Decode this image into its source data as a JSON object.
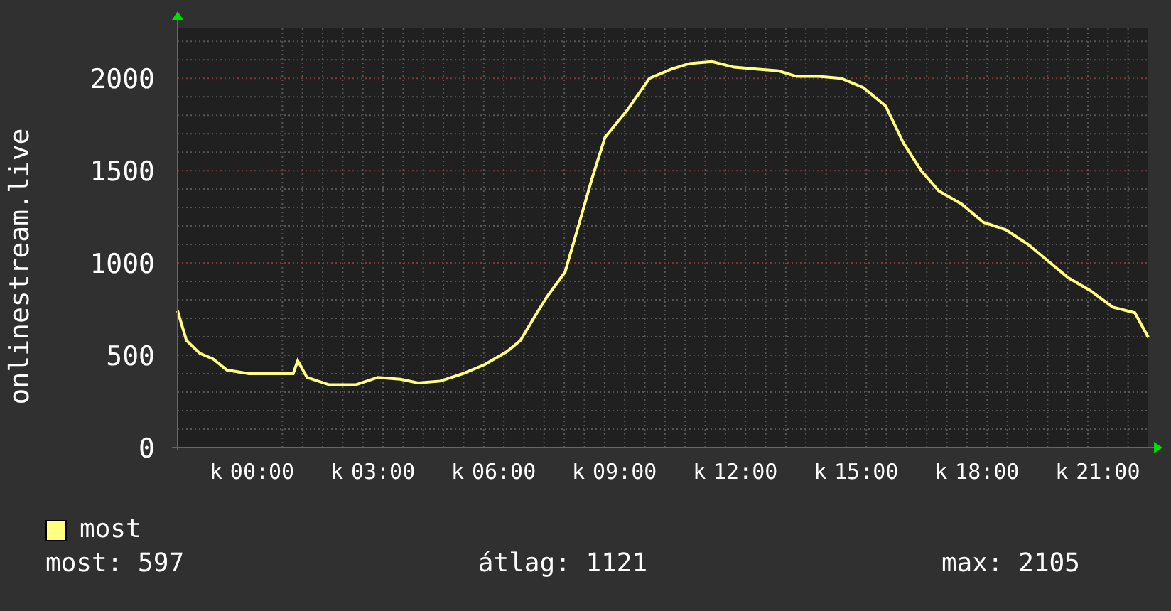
{
  "chart": {
    "chart_data": {
      "type": "line",
      "ylabel": "onlinestream.live",
      "grid": true,
      "x": [
        -2.1,
        -1.88,
        -1.55,
        -1.22,
        -0.88,
        -0.33,
        0.22,
        0.77,
        0.88,
        1.11,
        1.66,
        2.32,
        2.87,
        3.43,
        3.87,
        4.42,
        4.98,
        5.53,
        6.08,
        6.41,
        6.74,
        7.08,
        7.52,
        7.85,
        8.18,
        8.51,
        9.07,
        9.62,
        10.17,
        10.61,
        11.17,
        11.72,
        12.27,
        12.82,
        13.27,
        13.82,
        14.37,
        14.92,
        15.48,
        15.92,
        16.36,
        16.8,
        17.36,
        17.91,
        18.46,
        19.02,
        19.57,
        20.01,
        20.56,
        21.12,
        21.67,
        22.0
      ],
      "series": [
        {
          "name": "most",
          "color": "#ffff80",
          "values": [
            740,
            580,
            510,
            480,
            420,
            400,
            400,
            400,
            470,
            380,
            340,
            340,
            380,
            370,
            350,
            360,
            400,
            450,
            520,
            580,
            700,
            820,
            950,
            1200,
            1450,
            1680,
            1830,
            2000,
            2050,
            2080,
            2090,
            2060,
            2050,
            2040,
            2010,
            2010,
            2000,
            1950,
            1850,
            1650,
            1500,
            1390,
            1320,
            1220,
            1180,
            1100,
            1000,
            920,
            850,
            760,
            730,
            597
          ]
        }
      ],
      "xlim": [
        -2.1,
        22
      ],
      "ylim": [
        0,
        2270
      ],
      "xticks": [
        {
          "value": 0,
          "label": "00:00"
        },
        {
          "value": 3,
          "label": "03:00"
        },
        {
          "value": 6,
          "label": "06:00"
        },
        {
          "value": 9,
          "label": "09:00"
        },
        {
          "value": 12,
          "label": "12:00"
        },
        {
          "value": 15,
          "label": "15:00"
        },
        {
          "value": 18,
          "label": "18:00"
        },
        {
          "value": 21,
          "label": "21:00"
        }
      ],
      "yticks": [
        0,
        500,
        1000,
        1500,
        2000
      ]
    },
    "x_tick_prefixes": [
      "k",
      "k",
      "k",
      "k",
      "k",
      "k",
      "k",
      "k"
    ]
  },
  "stats": [
    "most: 597",
    "átlag: 1121",
    "max: 2105"
  ]
}
